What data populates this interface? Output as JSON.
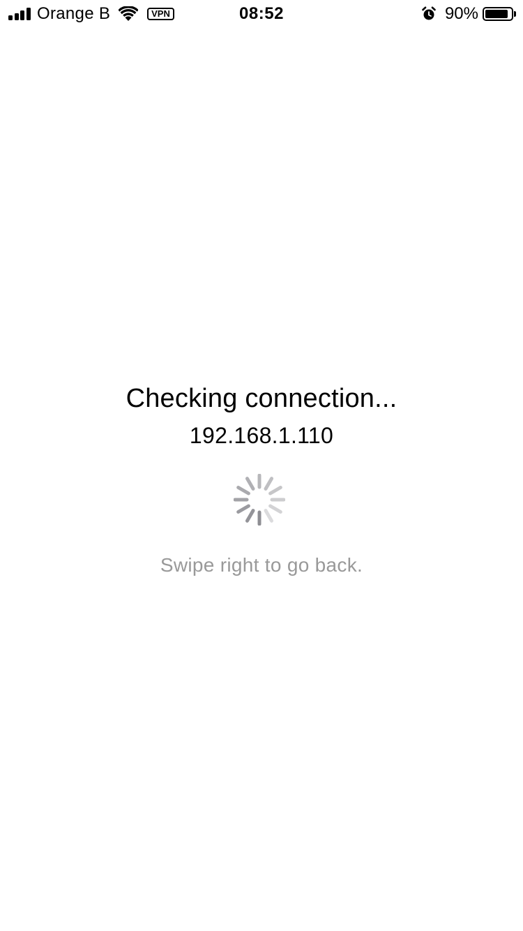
{
  "status_bar": {
    "carrier": "Orange B",
    "vpn": "VPN",
    "time": "08:52",
    "battery_percent_label": "90%",
    "battery_level": 0.9,
    "icons": [
      "signal-icon",
      "wifi-icon",
      "vpn-icon",
      "alarm-icon",
      "battery-icon"
    ]
  },
  "main": {
    "title": "Checking connection...",
    "address": "192.168.1.110",
    "hint": "Swipe right to go back.",
    "spinner_icon": "activity-spinner-icon"
  },
  "colors": {
    "text_primary": "#000000",
    "text_hint": "#999999",
    "spinner": "#8e8e93",
    "background": "#ffffff"
  }
}
